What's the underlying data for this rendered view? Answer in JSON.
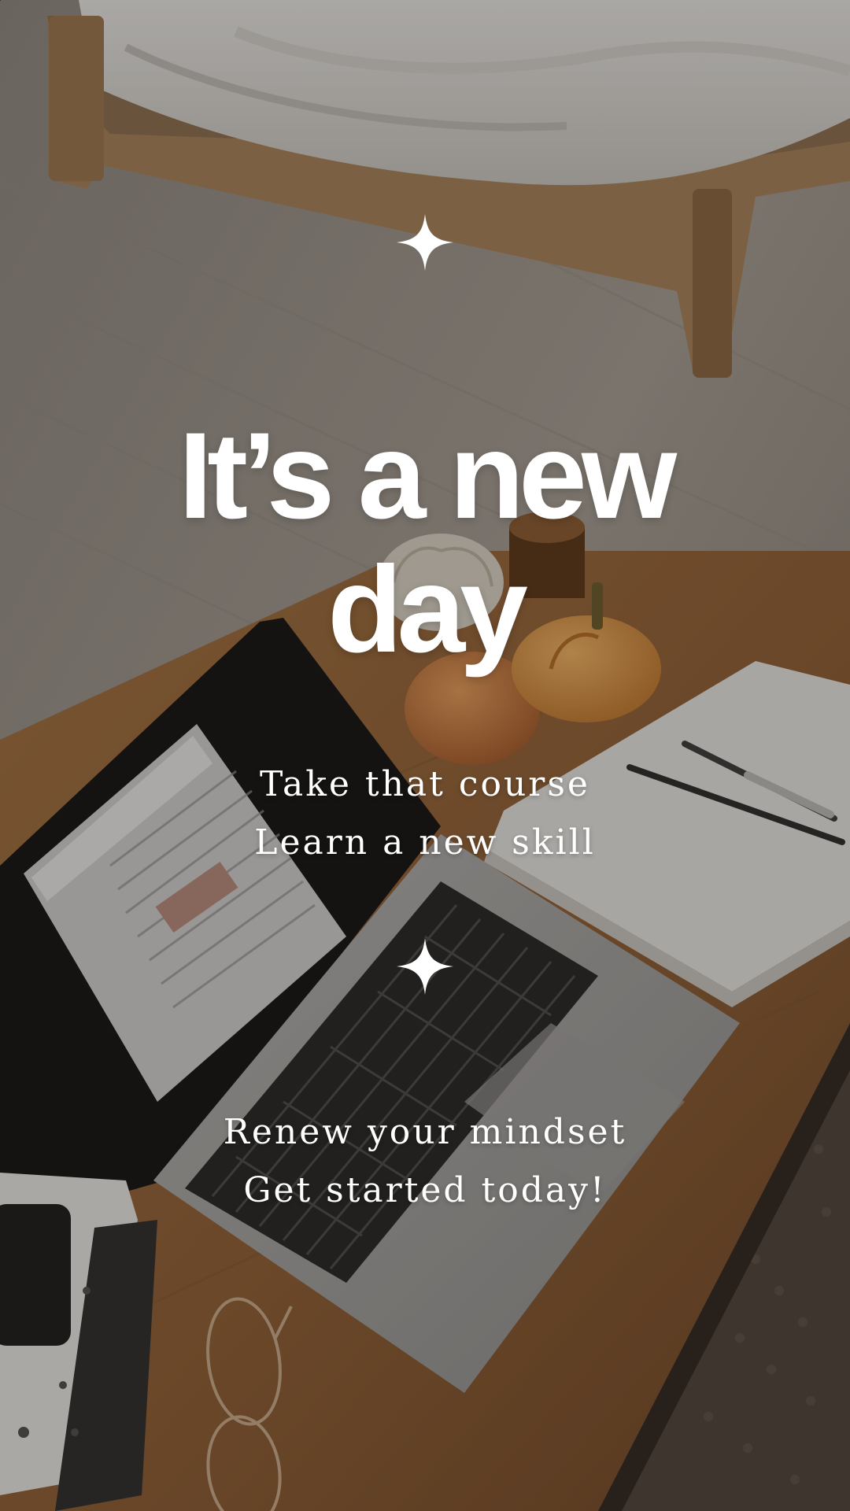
{
  "headline": {
    "line1": "It’s a new",
    "line2": "day"
  },
  "tagline_one": {
    "line1": "Take that course",
    "line2": "Learn a new skill"
  },
  "tagline_two": {
    "line1": "Renew your mindset",
    "line2": "Get started today!"
  },
  "icons": {
    "top": "sparkle-icon",
    "middle": "sparkle-icon"
  },
  "colors": {
    "text": "#ffffff",
    "wood": "#9a6a3e",
    "floor": "#a59d94"
  }
}
